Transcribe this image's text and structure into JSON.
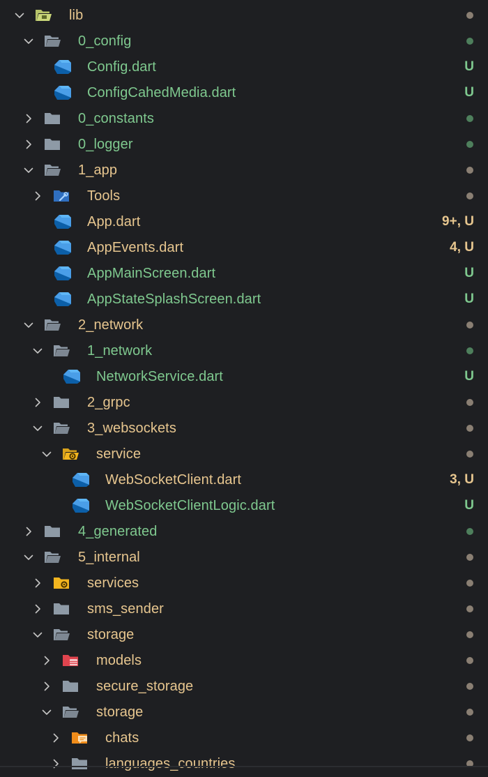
{
  "colors": {
    "background": "#1e1f22",
    "untracked": "#7fc98f",
    "modified": "#e7c68f",
    "muted_dot": "#8a7f73",
    "untracked_dot": "#4e7f5c",
    "chevron": "#c5c5c5",
    "folder": "#8e9aa6",
    "dart": "#4a9ee8"
  },
  "tree": [
    {
      "label": "lib",
      "depth": 0,
      "kind": "folder",
      "expanded": true,
      "icon": "lib-folder-icon",
      "status": "modified",
      "badge": ""
    },
    {
      "label": "0_config",
      "depth": 1,
      "kind": "folder",
      "expanded": true,
      "icon": "folder-open-icon",
      "status": "untracked",
      "badge": ""
    },
    {
      "label": "Config.dart",
      "depth": 2,
      "kind": "file",
      "icon": "dart-file-icon",
      "status": "untracked",
      "badge": "U"
    },
    {
      "label": "ConfigCahedMedia.dart",
      "depth": 2,
      "kind": "file",
      "icon": "dart-file-icon",
      "status": "untracked",
      "badge": "U"
    },
    {
      "label": "0_constants",
      "depth": 1,
      "kind": "folder",
      "expanded": false,
      "icon": "folder-icon",
      "status": "untracked",
      "badge": ""
    },
    {
      "label": "0_logger",
      "depth": 1,
      "kind": "folder",
      "expanded": false,
      "icon": "folder-icon",
      "status": "untracked",
      "badge": ""
    },
    {
      "label": "1_app",
      "depth": 1,
      "kind": "folder",
      "expanded": true,
      "icon": "folder-open-icon",
      "status": "modified",
      "badge": ""
    },
    {
      "label": "Tools",
      "depth": 2,
      "kind": "folder",
      "expanded": false,
      "icon": "tools-folder-icon",
      "status": "modified",
      "badge": ""
    },
    {
      "label": "App.dart",
      "depth": 2,
      "kind": "file",
      "icon": "dart-file-icon",
      "status": "modified",
      "badge": "9+, U"
    },
    {
      "label": "AppEvents.dart",
      "depth": 2,
      "kind": "file",
      "icon": "dart-file-icon",
      "status": "modified",
      "badge": "4, U"
    },
    {
      "label": "AppMainScreen.dart",
      "depth": 2,
      "kind": "file",
      "icon": "dart-file-icon",
      "status": "untracked",
      "badge": "U"
    },
    {
      "label": "AppStateSplashScreen.dart",
      "depth": 2,
      "kind": "file",
      "icon": "dart-file-icon",
      "status": "untracked",
      "badge": "U"
    },
    {
      "label": "2_network",
      "depth": 1,
      "kind": "folder",
      "expanded": true,
      "icon": "folder-open-icon",
      "status": "modified",
      "badge": ""
    },
    {
      "label": "1_network",
      "depth": 2,
      "kind": "folder",
      "expanded": true,
      "icon": "folder-open-icon",
      "status": "untracked",
      "badge": ""
    },
    {
      "label": "NetworkService.dart",
      "depth": 3,
      "kind": "file",
      "icon": "dart-file-icon",
      "status": "untracked",
      "badge": "U"
    },
    {
      "label": "2_grpc",
      "depth": 2,
      "kind": "folder",
      "expanded": false,
      "icon": "folder-icon",
      "status": "modified",
      "badge": ""
    },
    {
      "label": "3_websockets",
      "depth": 2,
      "kind": "folder",
      "expanded": true,
      "icon": "folder-open-icon",
      "status": "modified",
      "badge": ""
    },
    {
      "label": "service",
      "depth": 3,
      "kind": "folder",
      "expanded": true,
      "icon": "service-folder-icon",
      "status": "modified",
      "badge": ""
    },
    {
      "label": "WebSocketClient.dart",
      "depth": 4,
      "kind": "file",
      "icon": "dart-file-icon",
      "status": "modified",
      "badge": "3, U"
    },
    {
      "label": "WebSocketClientLogic.dart",
      "depth": 4,
      "kind": "file",
      "icon": "dart-file-icon",
      "status": "untracked",
      "badge": "U"
    },
    {
      "label": "4_generated",
      "depth": 1,
      "kind": "folder",
      "expanded": false,
      "icon": "folder-icon",
      "status": "untracked",
      "badge": ""
    },
    {
      "label": "5_internal",
      "depth": 1,
      "kind": "folder",
      "expanded": true,
      "icon": "folder-open-icon",
      "status": "modified",
      "badge": ""
    },
    {
      "label": "services",
      "depth": 2,
      "kind": "folder",
      "expanded": false,
      "icon": "services-folder-icon",
      "status": "modified",
      "badge": ""
    },
    {
      "label": "sms_sender",
      "depth": 2,
      "kind": "folder",
      "expanded": false,
      "icon": "folder-icon",
      "status": "modified",
      "badge": ""
    },
    {
      "label": "storage",
      "depth": 2,
      "kind": "folder",
      "expanded": true,
      "icon": "folder-open-icon",
      "status": "modified",
      "badge": ""
    },
    {
      "label": "models",
      "depth": 3,
      "kind": "folder",
      "expanded": false,
      "icon": "models-folder-icon",
      "status": "modified",
      "badge": ""
    },
    {
      "label": "secure_storage",
      "depth": 3,
      "kind": "folder",
      "expanded": false,
      "icon": "folder-icon",
      "status": "modified",
      "badge": ""
    },
    {
      "label": "storage",
      "depth": 3,
      "kind": "folder",
      "expanded": true,
      "icon": "folder-open-icon",
      "status": "modified",
      "badge": ""
    },
    {
      "label": "chats",
      "depth": 4,
      "kind": "folder",
      "expanded": false,
      "icon": "chats-folder-icon",
      "status": "modified",
      "badge": ""
    },
    {
      "label": "languages_countries",
      "depth": 4,
      "kind": "folder",
      "expanded": false,
      "icon": "folder-icon",
      "status": "modified",
      "badge": ""
    }
  ]
}
